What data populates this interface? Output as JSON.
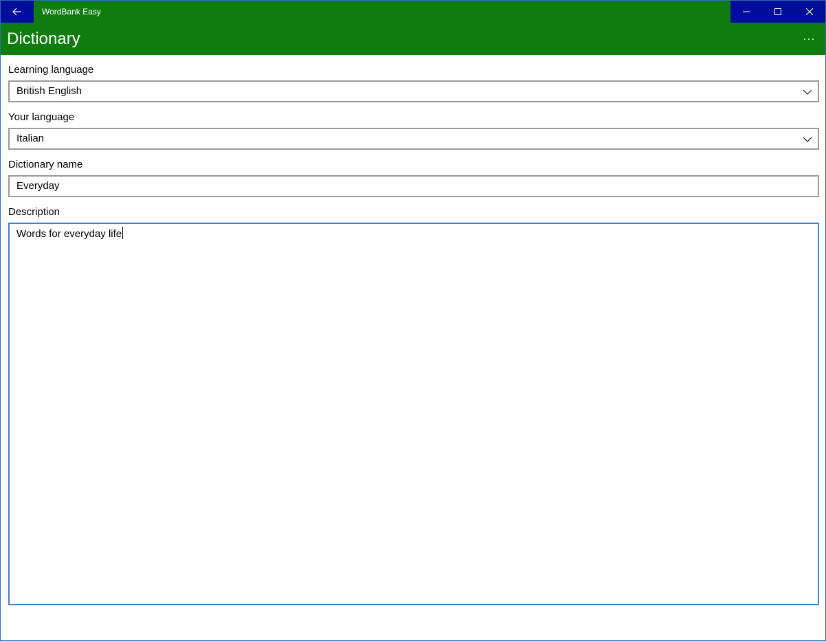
{
  "window": {
    "app_title": "WordBank Easy",
    "back_icon": "back-arrow-icon",
    "minimize_icon": "minimize-icon",
    "maximize_icon": "maximize-icon",
    "close_icon": "close-icon"
  },
  "header": {
    "title": "Dictionary",
    "more_icon": "more-ellipsis-icon",
    "more_label": "···"
  },
  "form": {
    "learning_language": {
      "label": "Learning language",
      "value": "British English"
    },
    "your_language": {
      "label": "Your language",
      "value": "Italian"
    },
    "dictionary_name": {
      "label": "Dictionary name",
      "value": "Everyday"
    },
    "description": {
      "label": "Description",
      "value": "Words for everyday life"
    }
  },
  "colors": {
    "accent_green": "#107c10",
    "caption_blue": "#000c9c",
    "focus_border": "#3f7fc3",
    "input_border": "#999999"
  }
}
